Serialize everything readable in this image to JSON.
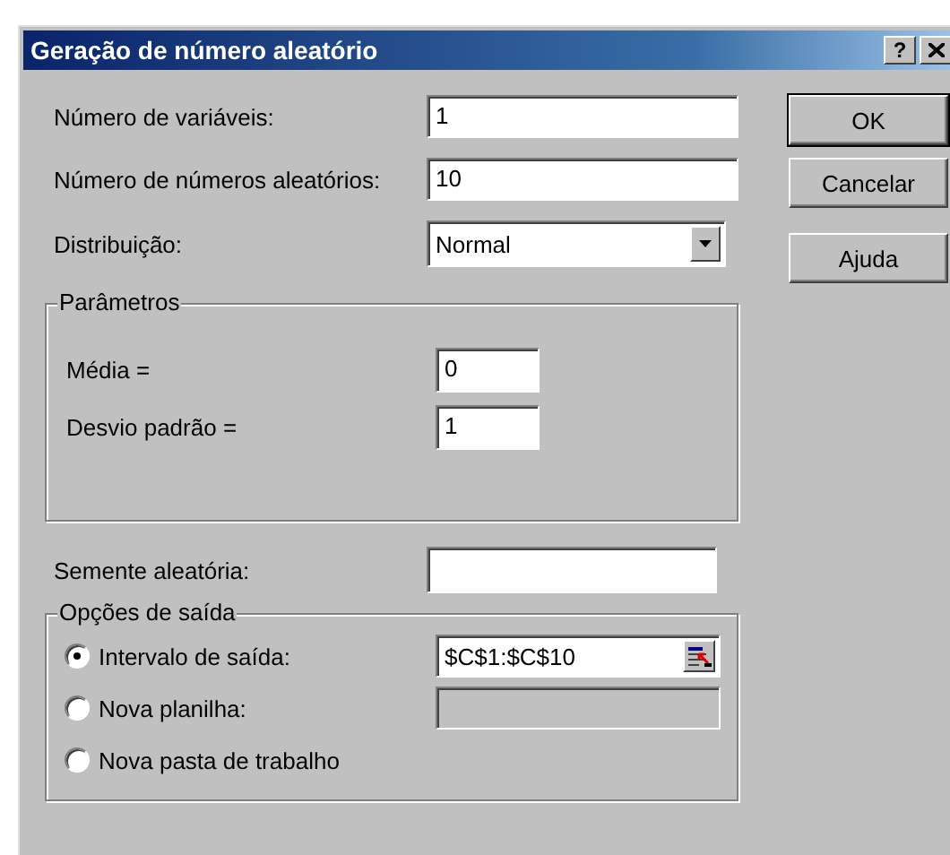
{
  "window": {
    "title": "Geração de número aleatório",
    "help_button": "?"
  },
  "fields": [
    {
      "label": "Número de variáveis:",
      "value": "1"
    },
    {
      "label": "Número de números aleatórios:",
      "value": "10"
    }
  ],
  "distribution": {
    "label": "Distribuição:",
    "value": "Normal"
  },
  "buttons": [
    {
      "label": "OK",
      "default": true
    },
    {
      "label": "Cancelar",
      "default": false
    },
    {
      "label": "Ajuda",
      "default": false
    }
  ],
  "parameters": {
    "title": "Parâmetros",
    "fields": [
      {
        "label": "Média =",
        "value": "0"
      },
      {
        "label": "Desvio padrão =",
        "value": "1"
      }
    ]
  },
  "seed": {
    "label": "Semente aleatória:"
  },
  "output_options": {
    "title": "Opções de saída",
    "options": [
      {
        "label": "Intervalo de saída:",
        "selected": true,
        "kind": "range",
        "value": "$C$1:$C$10"
      },
      {
        "label": "Nova planilha:",
        "selected": false,
        "kind": "text"
      },
      {
        "label": "Nova pasta de trabalho",
        "selected": false,
        "kind": "plain"
      }
    ]
  }
}
